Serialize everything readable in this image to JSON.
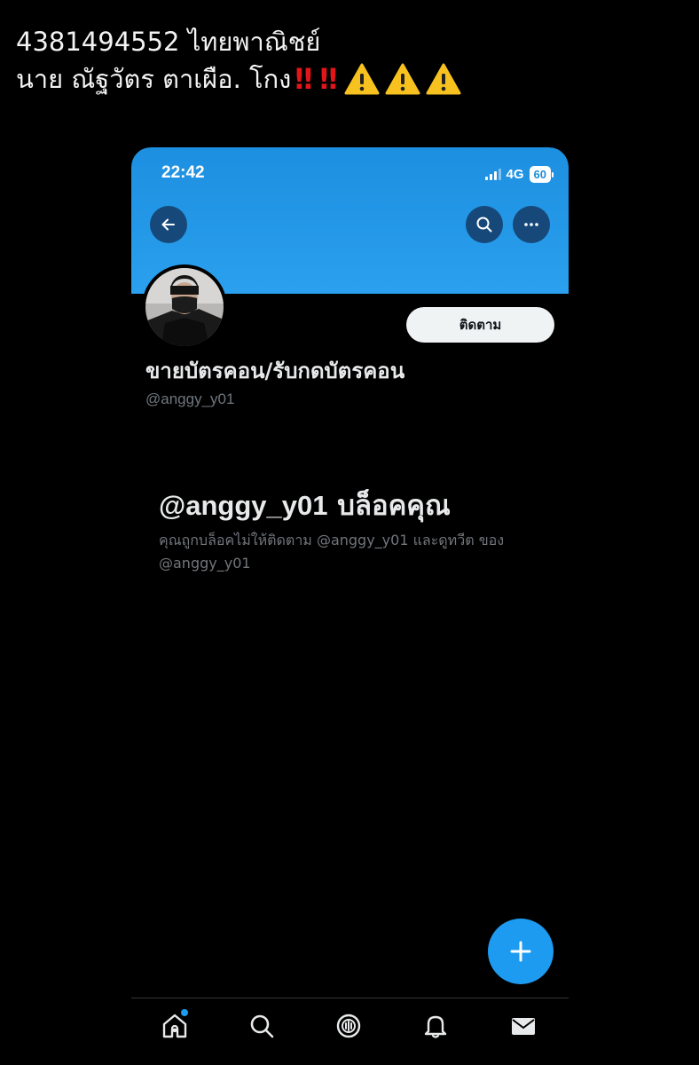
{
  "caption": {
    "line1": "4381494552 ไทยพาณิชย์",
    "line2": "นาย ณัฐวัตร ตาเผือ. โกง",
    "bangs": [
      "‼",
      "‼"
    ],
    "warnings": [
      "warning-icon",
      "warning-icon",
      "warning-icon"
    ]
  },
  "status_bar": {
    "time": "22:42",
    "network": "4G",
    "battery": "60"
  },
  "profile": {
    "follow_label": "ติดตาม",
    "display_name": "ขายบัตรคอน/รับกดบัตรคอน",
    "handle": "@anggy_y01"
  },
  "blocked": {
    "title_handle": "@anggy_y01",
    "title_text": " บล็อคคุณ",
    "description": "คุณถูกบล็อคไม่ให้ติดตาม @anggy_y01 และดูทวีต ของ @anggy_y01"
  },
  "icons": {
    "back": "arrow-left-icon",
    "search": "search-icon",
    "more": "more-icon",
    "compose": "plus-icon",
    "tabs": [
      "home-icon",
      "search-icon",
      "spaces-icon",
      "bell-icon",
      "mail-icon"
    ]
  },
  "colors": {
    "banner": "#1d9bf0",
    "accent": "#1d9bf0",
    "background": "#000000"
  }
}
